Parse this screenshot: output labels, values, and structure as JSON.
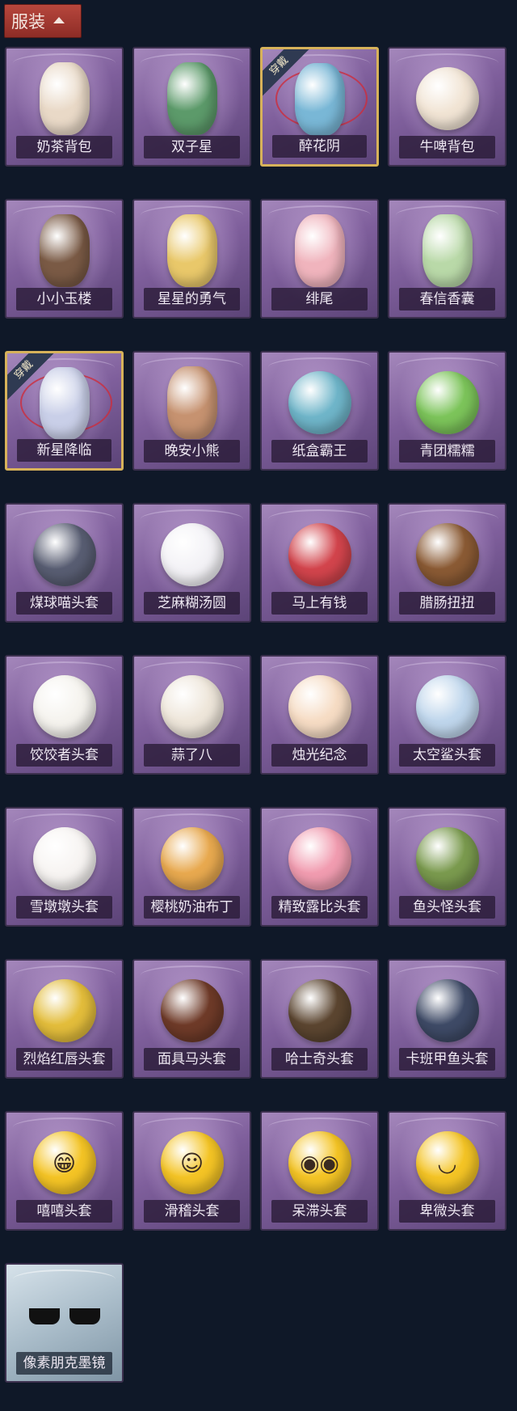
{
  "header": {
    "title": "服装"
  },
  "badge_label": "穿戴",
  "items": [
    {
      "name": "奶茶背包",
      "equipped": false,
      "icon": "milk-tea-backpack",
      "color": "#e9d9c7"
    },
    {
      "name": "双子星",
      "equipped": false,
      "icon": "gemini-star-charm",
      "color": "#5c9a6a"
    },
    {
      "name": "醉花阴",
      "equipped": true,
      "icon": "flower-dreamcatcher",
      "color": "#79b7d6"
    },
    {
      "name": "牛啤背包",
      "equipped": false,
      "icon": "cow-beer-barrel",
      "color": "#f1e4d4"
    },
    {
      "name": "小小玉楼",
      "equipped": false,
      "icon": "little-jade-tower-charm",
      "color": "#7a5a45"
    },
    {
      "name": "星星的勇气",
      "equipped": false,
      "icon": "star-courage-charm",
      "color": "#e9c86a"
    },
    {
      "name": "绯尾",
      "equipped": false,
      "icon": "pink-fox-charm",
      "color": "#f0b4bd"
    },
    {
      "name": "春信香囊",
      "equipped": false,
      "icon": "spring-sachet",
      "color": "#b9d9a8"
    },
    {
      "name": "新星降临",
      "equipped": true,
      "icon": "nova-arrival-charm",
      "color": "#c9cfe8"
    },
    {
      "name": "晚安小熊",
      "equipped": false,
      "icon": "goodnight-bear-charm",
      "color": "#c69270"
    },
    {
      "name": "纸盒霸王",
      "equipped": false,
      "icon": "cardboard-dino",
      "color": "#6fb5c9"
    },
    {
      "name": "青团糯糯",
      "equipped": false,
      "icon": "green-rice-ball",
      "color": "#7cc45a"
    },
    {
      "name": "煤球喵头套",
      "equipped": false,
      "icon": "coal-cat-headgear",
      "color": "#585d72"
    },
    {
      "name": "芝麻糊汤圆",
      "equipped": false,
      "icon": "sesame-dumpling-headgear",
      "color": "#f3f2f6"
    },
    {
      "name": "马上有钱",
      "equipped": false,
      "icon": "red-horse-headgear",
      "color": "#d2444c"
    },
    {
      "name": "腊肠扭扭",
      "equipped": false,
      "icon": "sausage-dog-headgear",
      "color": "#8a5a34"
    },
    {
      "name": "饺饺者头套",
      "equipped": false,
      "icon": "dumpling-headgear",
      "color": "#f5f3ee"
    },
    {
      "name": "蒜了八",
      "equipped": false,
      "icon": "garlic-headgear",
      "color": "#eee6da"
    },
    {
      "name": "烛光纪念",
      "equipped": false,
      "icon": "candle-headgear",
      "color": "#f6dcc4"
    },
    {
      "name": "太空鲨头套",
      "equipped": false,
      "icon": "space-shark-headgear",
      "color": "#bfd6ec"
    },
    {
      "name": "雪墩墩头套",
      "equipped": false,
      "icon": "snow-reindeer-headgear",
      "color": "#f7f4f2"
    },
    {
      "name": "樱桃奶油布丁",
      "equipped": false,
      "icon": "cherry-pudding-headgear",
      "color": "#e8a94f"
    },
    {
      "name": "精致露比头套",
      "equipped": false,
      "icon": "ruby-glasses-headgear",
      "color": "#f19cb0"
    },
    {
      "name": "鱼头怪头套",
      "equipped": false,
      "icon": "fish-monster-headgear",
      "color": "#7a9a4e"
    },
    {
      "name": "烈焰红唇头套",
      "equipped": false,
      "icon": "red-lips-headgear",
      "color": "#e3bd3b"
    },
    {
      "name": "面具马头套",
      "equipped": false,
      "icon": "horse-mask-headgear",
      "color": "#6e3a28"
    },
    {
      "name": "哈士奇头套",
      "equipped": false,
      "icon": "husky-headgear",
      "color": "#5b4530"
    },
    {
      "name": "卡班甲鱼头套",
      "equipped": false,
      "icon": "cabanja-fish-headgear",
      "color": "#3e4a66"
    },
    {
      "name": "嘻嘻头套",
      "equipped": false,
      "icon": "grin-emoji-headgear",
      "color": "#f4c425"
    },
    {
      "name": "滑稽头套",
      "equipped": false,
      "icon": "funny-emoji-headgear",
      "color": "#f4c425"
    },
    {
      "name": "呆滞头套",
      "equipped": false,
      "icon": "dazed-emoji-headgear",
      "color": "#f4c425"
    },
    {
      "name": "卑微头套",
      "equipped": false,
      "icon": "humble-emoji-headgear",
      "color": "#f4c425"
    },
    {
      "name": "像素朋克墨镜",
      "equipped": false,
      "icon": "pixel-punk-sunglasses",
      "color": "#111111",
      "pale": true
    }
  ]
}
